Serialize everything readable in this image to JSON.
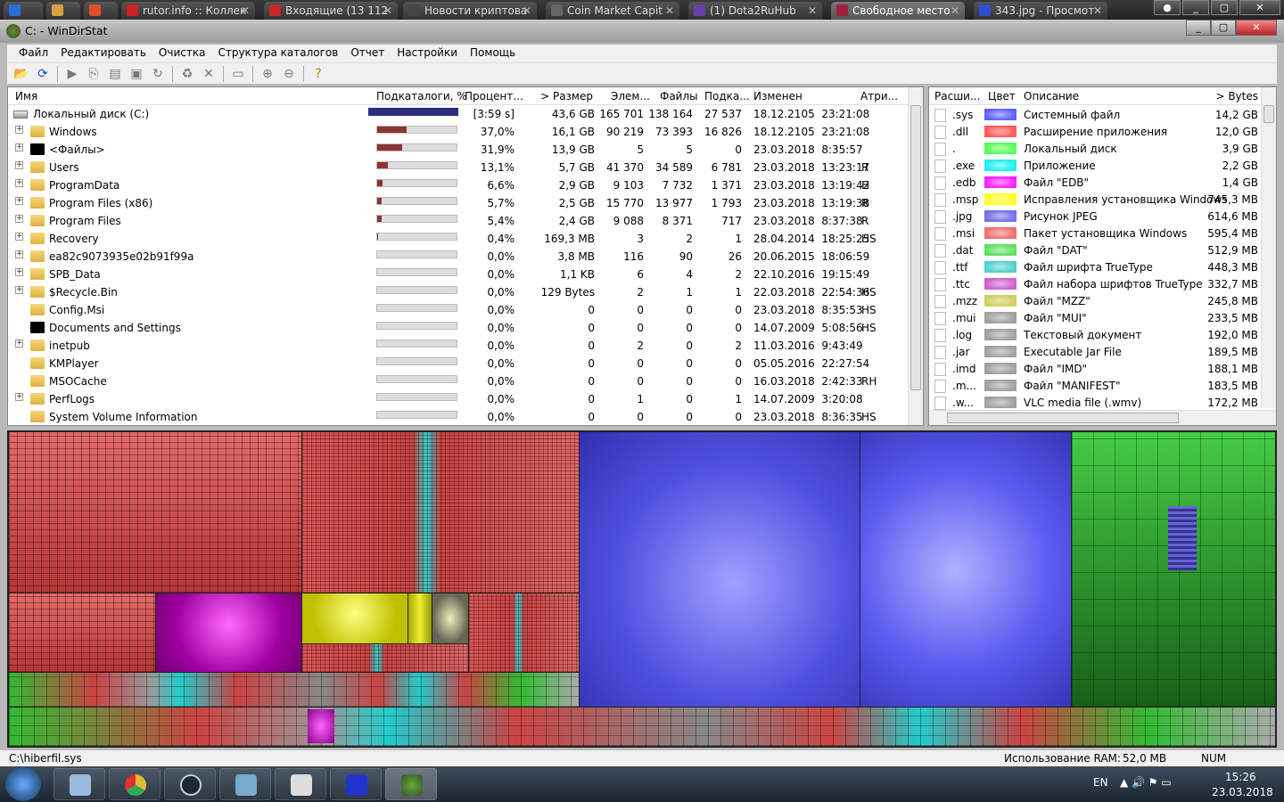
{
  "browser_tabs": [
    {
      "label": "",
      "color": "#2a6ed6"
    },
    {
      "label": "",
      "color": "#d9a040"
    },
    {
      "label": "",
      "color": "#e0502a"
    },
    {
      "label": "rutor.info :: Коллек",
      "color": "#d02020"
    },
    {
      "label": "Входящие (13 112",
      "color": "#c62828"
    },
    {
      "label": "Новости криптова",
      "color": "#444"
    },
    {
      "label": "Coin Market Capit",
      "color": "#666"
    },
    {
      "label": "(1) Dota2RuHub",
      "color": "#6441a4"
    },
    {
      "label": "Свободное место",
      "color": "#a02040"
    },
    {
      "label": "343.jpg - Просмот",
      "color": "#3050d0"
    }
  ],
  "window": {
    "title": "C: - WinDirStat"
  },
  "menu": [
    "Файл",
    "Редактировать",
    "Очистка",
    "Структура каталогов",
    "Отчет",
    "Настройки",
    "Помощь"
  ],
  "tree": {
    "headers": {
      "name": "Имя",
      "subtree": "Подкаталоги, %",
      "percent": "Процент...",
      "size": "> Размер",
      "items": "Элем...",
      "files": "Файлы",
      "subdirs": "Подка...",
      "modified": "Изменен",
      "attr": "Атри..."
    },
    "rows": [
      {
        "name": "Локальный диск (C:)",
        "pct": "[3:59 s]",
        "fill": 100,
        "size": "43,6 GB",
        "items": "165 701",
        "files": "138 164",
        "subdirs": "27 537",
        "modified": "18.12.2105  23:21:08",
        "attr": "",
        "type": "drive"
      },
      {
        "name": "Windows",
        "pct": "37,0%",
        "fill": 37,
        "size": "16,1 GB",
        "items": "90 219",
        "files": "73 393",
        "subdirs": "16 826",
        "modified": "18.12.2105  23:21:08",
        "attr": "",
        "type": "folder",
        "exp": true
      },
      {
        "name": "<Файлы>",
        "pct": "31,9%",
        "fill": 31.9,
        "size": "13,9 GB",
        "items": "5",
        "files": "5",
        "subdirs": "0",
        "modified": "23.03.2018  8:35:57",
        "attr": "",
        "type": "files",
        "exp": true
      },
      {
        "name": "Users",
        "pct": "13,1%",
        "fill": 13.1,
        "size": "5,7 GB",
        "items": "41 370",
        "files": "34 589",
        "subdirs": "6 781",
        "modified": "23.03.2018  13:23:17",
        "attr": "R",
        "type": "folder",
        "exp": true
      },
      {
        "name": "ProgramData",
        "pct": "6,6%",
        "fill": 6.6,
        "size": "2,9 GB",
        "items": "9 103",
        "files": "7 732",
        "subdirs": "1 371",
        "modified": "23.03.2018  13:19:42",
        "attr": "H",
        "type": "folder",
        "exp": true
      },
      {
        "name": "Program Files (x86)",
        "pct": "5,7%",
        "fill": 5.7,
        "size": "2,5 GB",
        "items": "15 770",
        "files": "13 977",
        "subdirs": "1 793",
        "modified": "23.03.2018  13:19:38",
        "attr": "R",
        "type": "folder",
        "exp": true
      },
      {
        "name": "Program Files",
        "pct": "5,4%",
        "fill": 5.4,
        "size": "2,4 GB",
        "items": "9 088",
        "files": "8 371",
        "subdirs": "717",
        "modified": "23.03.2018  8:37:38",
        "attr": "R",
        "type": "folder",
        "exp": true
      },
      {
        "name": "Recovery",
        "pct": "0,4%",
        "fill": 0.4,
        "size": "169,3 MB",
        "items": "3",
        "files": "2",
        "subdirs": "1",
        "modified": "28.04.2014  18:25:25",
        "attr": "HS",
        "type": "folder",
        "exp": true
      },
      {
        "name": "ea82c9073935e02b91f99a",
        "pct": "0,0%",
        "fill": 0,
        "size": "3,8 MB",
        "items": "116",
        "files": "90",
        "subdirs": "26",
        "modified": "20.06.2015  18:06:59",
        "attr": "",
        "type": "folder",
        "exp": true
      },
      {
        "name": "SPB_Data",
        "pct": "0,0%",
        "fill": 0,
        "size": "1,1 KB",
        "items": "6",
        "files": "4",
        "subdirs": "2",
        "modified": "22.10.2016  19:15:49",
        "attr": "",
        "type": "folder",
        "exp": true
      },
      {
        "name": "$Recycle.Bin",
        "pct": "0,0%",
        "fill": 0,
        "size": "129 Bytes",
        "items": "2",
        "files": "1",
        "subdirs": "1",
        "modified": "22.03.2018  22:54:36",
        "attr": "HS",
        "type": "folder",
        "exp": true
      },
      {
        "name": "Config.Msi",
        "pct": "0,0%",
        "fill": 0,
        "size": "0",
        "items": "0",
        "files": "0",
        "subdirs": "0",
        "modified": "23.03.2018  8:35:53",
        "attr": "HS",
        "type": "folder",
        "exp": false
      },
      {
        "name": "Documents and Settings",
        "pct": "0,0%",
        "fill": 0,
        "size": "0",
        "items": "0",
        "files": "0",
        "subdirs": "0",
        "modified": "14.07.2009  5:08:56",
        "attr": "HS",
        "type": "files",
        "exp": false
      },
      {
        "name": "inetpub",
        "pct": "0,0%",
        "fill": 0,
        "size": "0",
        "items": "2",
        "files": "0",
        "subdirs": "2",
        "modified": "11.03.2016  9:43:49",
        "attr": "",
        "type": "folder",
        "exp": true
      },
      {
        "name": "KMPlayer",
        "pct": "0,0%",
        "fill": 0,
        "size": "0",
        "items": "0",
        "files": "0",
        "subdirs": "0",
        "modified": "05.05.2016  22:27:54",
        "attr": "",
        "type": "folder",
        "exp": false
      },
      {
        "name": "MSOCache",
        "pct": "0,0%",
        "fill": 0,
        "size": "0",
        "items": "0",
        "files": "0",
        "subdirs": "0",
        "modified": "16.03.2018  2:42:33",
        "attr": "RH",
        "type": "folder",
        "exp": false
      },
      {
        "name": "PerfLogs",
        "pct": "0,0%",
        "fill": 0,
        "size": "0",
        "items": "1",
        "files": "0",
        "subdirs": "1",
        "modified": "14.07.2009  3:20:08",
        "attr": "",
        "type": "folder",
        "exp": true
      },
      {
        "name": "System Volume Information",
        "pct": "0,0%",
        "fill": 0,
        "size": "0",
        "items": "0",
        "files": "0",
        "subdirs": "0",
        "modified": "23.03.2018  8:36:35",
        "attr": "HS",
        "type": "folder",
        "exp": false
      }
    ]
  },
  "extensions": {
    "headers": {
      "ext": "Расши...",
      "color": "Цвет",
      "desc": "Описание",
      "bytes": "> Bytes"
    },
    "rows": [
      {
        "ext": ".sys",
        "color": "#6060ff",
        "desc": "Системный файл",
        "bytes": "14,2 GB"
      },
      {
        "ext": ".dll",
        "color": "#ff5a5a",
        "desc": "Расширение приложения",
        "bytes": "12,0 GB"
      },
      {
        "ext": ".",
        "color": "#5aff5a",
        "desc": "Локальный диск",
        "bytes": "3,9 GB"
      },
      {
        "ext": ".exe",
        "color": "#20f0f0",
        "desc": "Приложение",
        "bytes": "2,2 GB"
      },
      {
        "ext": ".edb",
        "color": "#ff20ff",
        "desc": "Файл \"EDB\"",
        "bytes": "1,4 GB"
      },
      {
        "ext": ".msp",
        "color": "#ffff20",
        "desc": "Исправления установщика Windows",
        "bytes": "745,3 MB"
      },
      {
        "ext": ".jpg",
        "color": "#7070e8",
        "desc": "Рисунок JPEG",
        "bytes": "614,6 MB"
      },
      {
        "ext": ".msi",
        "color": "#f07070",
        "desc": "Пакет установщика Windows",
        "bytes": "595,4 MB"
      },
      {
        "ext": ".dat",
        "color": "#60e060",
        "desc": "Файл \"DAT\"",
        "bytes": "512,9 MB"
      },
      {
        "ext": ".ttf",
        "color": "#50d0d0",
        "desc": "Файл шрифта TrueType",
        "bytes": "448,3 MB"
      },
      {
        "ext": ".ttc",
        "color": "#d060d0",
        "desc": "Файл набора шрифтов TrueType",
        "bytes": "332,7 MB"
      },
      {
        "ext": ".mzz",
        "color": "#d0d060",
        "desc": "Файл \"MZZ\"",
        "bytes": "245,8 MB"
      },
      {
        "ext": ".mui",
        "color": "#a0a0a0",
        "desc": "Файл \"MUI\"",
        "bytes": "233,5 MB"
      },
      {
        "ext": ".log",
        "color": "#a0a0a0",
        "desc": "Текстовый документ",
        "bytes": "192,0 MB"
      },
      {
        "ext": ".jar",
        "color": "#a0a0a0",
        "desc": "Executable Jar File",
        "bytes": "189,5 MB"
      },
      {
        "ext": ".imd",
        "color": "#a0a0a0",
        "desc": "Файл \"IMD\"",
        "bytes": "188,1 MB"
      },
      {
        "ext": ".m...",
        "color": "#a0a0a0",
        "desc": "Файл \"MANIFEST\"",
        "bytes": "183,5 MB"
      },
      {
        "ext": ".w...",
        "color": "#a0a0a0",
        "desc": "VLC media file (.wmv)",
        "bytes": "172,2 MB"
      }
    ]
  },
  "status": {
    "path": "C:\\hiberfil.sys",
    "ram_label": "Использование RAM:",
    "ram_value": "52,0 MB",
    "num": "NUM"
  },
  "tray": {
    "lang": "EN",
    "time": "15:26",
    "date": "23.03.2018"
  }
}
